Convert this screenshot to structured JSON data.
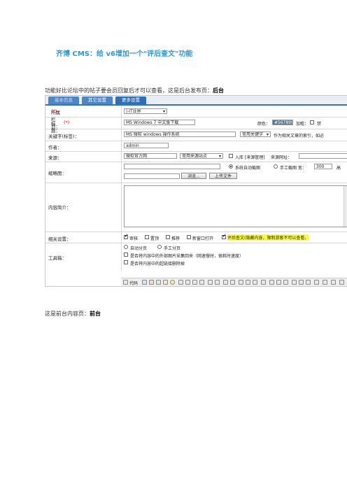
{
  "title": "齐博 CMS：给 v6增加一个\"评后查文\"功能",
  "intro": {
    "text": "功能好比论坛中的帖子要会员回复后才可以查看，这是后台发布页：",
    "bold": "后台"
  },
  "outro": {
    "text": "这是前台内容页：",
    "bold": "前台"
  },
  "form": {
    "tabs": [
      "基本信息",
      "其它设置",
      "更多设置"
    ],
    "column_label": "所属栏目：",
    "column_req": "(*)",
    "column_value": "|-IT业界",
    "title_label": "标题：",
    "title_req": "(*)",
    "title_value": "MS Windows 7 中文版下载",
    "color_label": "颜色：",
    "color_value": "#567899",
    "bold_label": "加粗：",
    "extra_label": "禁",
    "keyword_label": "关键字(标签)：",
    "keyword_value": "MS 微软 windows 操作系统",
    "keyword_select": "常用关键字",
    "keyword_hint": "作为相关文章的索引，如必",
    "author_label": "作者：",
    "author_value": "admin",
    "source_label": "来源：",
    "source_value": "微软官方网",
    "source_select": "常用来源站点",
    "source_lib": "入库 [来源管理]",
    "source_url_label": "来源网址：",
    "thumb_label": "缩略图：",
    "thumb_auto": "系统自动截图",
    "thumb_manual": "手工截图 宽：",
    "thumb_width": "300",
    "thumb_height_label": "高",
    "browse_btn": "浏览...",
    "upload_btn": "上传文件",
    "summary_label": "内容简介：",
    "settings_label": "相关设置：",
    "settings": [
      "审核",
      "置顶",
      "推荐",
      "新窗口打开",
      "评后查文(隐藏内容，限制游客不可以查看，"
    ],
    "tools_label": "工具箱：",
    "tools_paging": [
      "自动分页",
      "手工分页"
    ],
    "tools_options": [
      "是否将内容中的外部图片采集回来（网速慢时，很耗时速度）",
      "是否将内容中的超链接删除掉"
    ],
    "toolbar_code": "代码"
  }
}
